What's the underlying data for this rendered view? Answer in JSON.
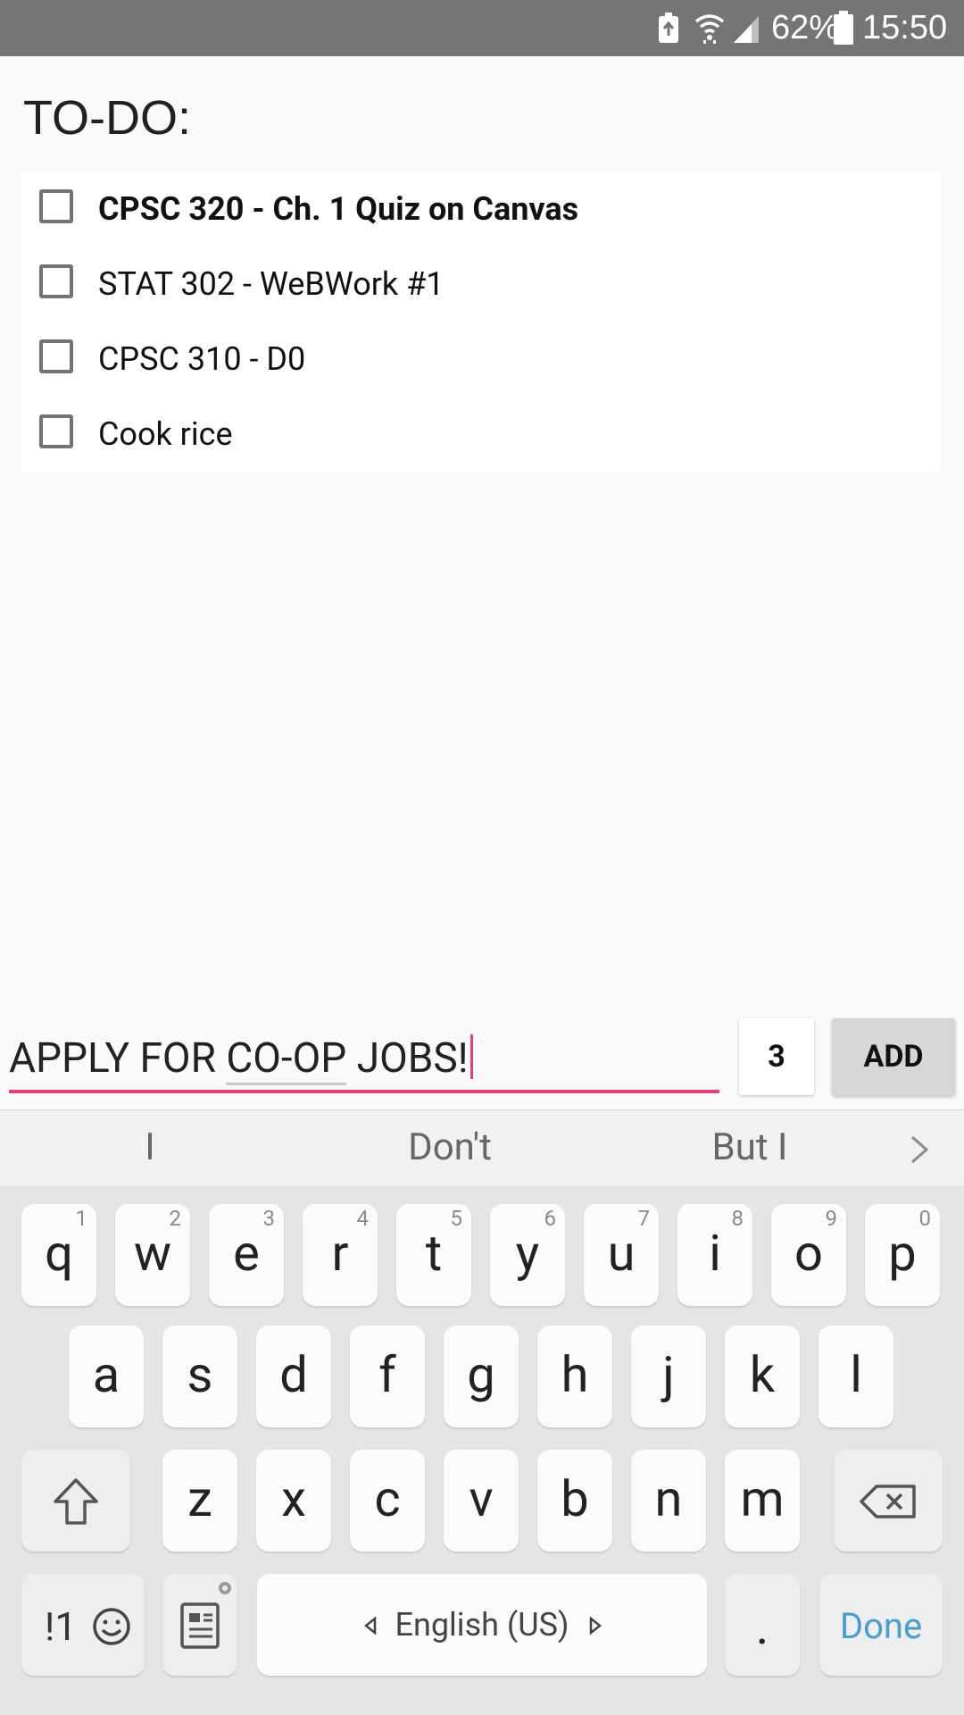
{
  "status_bar": {
    "battery_percent": "62%",
    "time": "15:50",
    "icons": [
      "battery-saver-icon",
      "wifi-icon",
      "cell-signal-icon",
      "battery-icon"
    ]
  },
  "page": {
    "title": "TO-DO:"
  },
  "todo_items": [
    {
      "label": "CPSC 320 - Ch. 1 Quiz on Canvas",
      "checked": false,
      "bold": true
    },
    {
      "label": "STAT 302 - WeBWork #1",
      "checked": false,
      "bold": false
    },
    {
      "label": "CPSC 310 - D0",
      "checked": false,
      "bold": false
    },
    {
      "label": "Cook rice",
      "checked": false,
      "bold": false
    }
  ],
  "input": {
    "value_before": "APPLY FOR ",
    "value_composing": "CO-OP",
    "value_after": " JOBS!"
  },
  "priority": "3",
  "add_button": "ADD",
  "keyboard": {
    "suggestions": [
      "I",
      "Don't",
      "But I"
    ],
    "row1": [
      {
        "ch": "q",
        "hint": "1"
      },
      {
        "ch": "w",
        "hint": "2"
      },
      {
        "ch": "e",
        "hint": "3"
      },
      {
        "ch": "r",
        "hint": "4"
      },
      {
        "ch": "t",
        "hint": "5"
      },
      {
        "ch": "y",
        "hint": "6"
      },
      {
        "ch": "u",
        "hint": "7"
      },
      {
        "ch": "i",
        "hint": "8"
      },
      {
        "ch": "o",
        "hint": "9"
      },
      {
        "ch": "p",
        "hint": "0"
      }
    ],
    "row2": [
      "a",
      "s",
      "d",
      "f",
      "g",
      "h",
      "j",
      "k",
      "l"
    ],
    "row3": [
      "z",
      "x",
      "c",
      "v",
      "b",
      "n",
      "m"
    ],
    "symbols_key": "!1",
    "space_label": "English (US)",
    "period": ".",
    "done": "Done"
  }
}
